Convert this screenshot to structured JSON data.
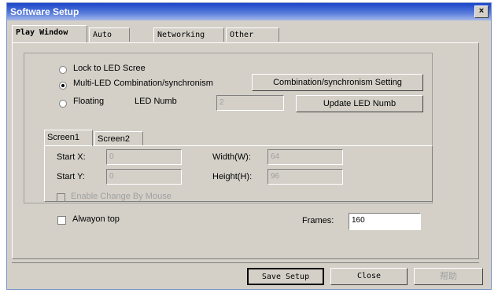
{
  "window": {
    "title": "Software Setup",
    "close_label": "×"
  },
  "tabs": [
    {
      "label": "Play Window"
    },
    {
      "label": "Auto"
    },
    {
      "label": "Networking"
    },
    {
      "label": "Other"
    }
  ],
  "mode": {
    "lock_label": "Lock to LED Scree",
    "multi_label": "Multi-LED Combination/synchronism",
    "floating_label": "Floating",
    "led_numb_label": "LED Numb",
    "led_numb_value": "2",
    "selected": "multi"
  },
  "buttons": {
    "combination_setting": "Combination/synchronism Setting",
    "update_led_numb": "Update LED Numb",
    "save_setup": "Save Setup",
    "close": "Close",
    "help": "帮助"
  },
  "screen_tabs": [
    {
      "label": "Screen1"
    },
    {
      "label": "Screen2"
    }
  ],
  "screen": {
    "start_x_label": "Start X:",
    "start_x_value": "0",
    "start_y_label": "Start Y:",
    "start_y_value": "0",
    "width_label": "Width(W):",
    "width_value": "64",
    "height_label": "Height(H):",
    "height_value": "96",
    "enable_change_label": "Enable Change By Mouse"
  },
  "options": {
    "always_on_top_label": "Alwayon top",
    "frames_label": "Frames:",
    "frames_value": "160"
  }
}
